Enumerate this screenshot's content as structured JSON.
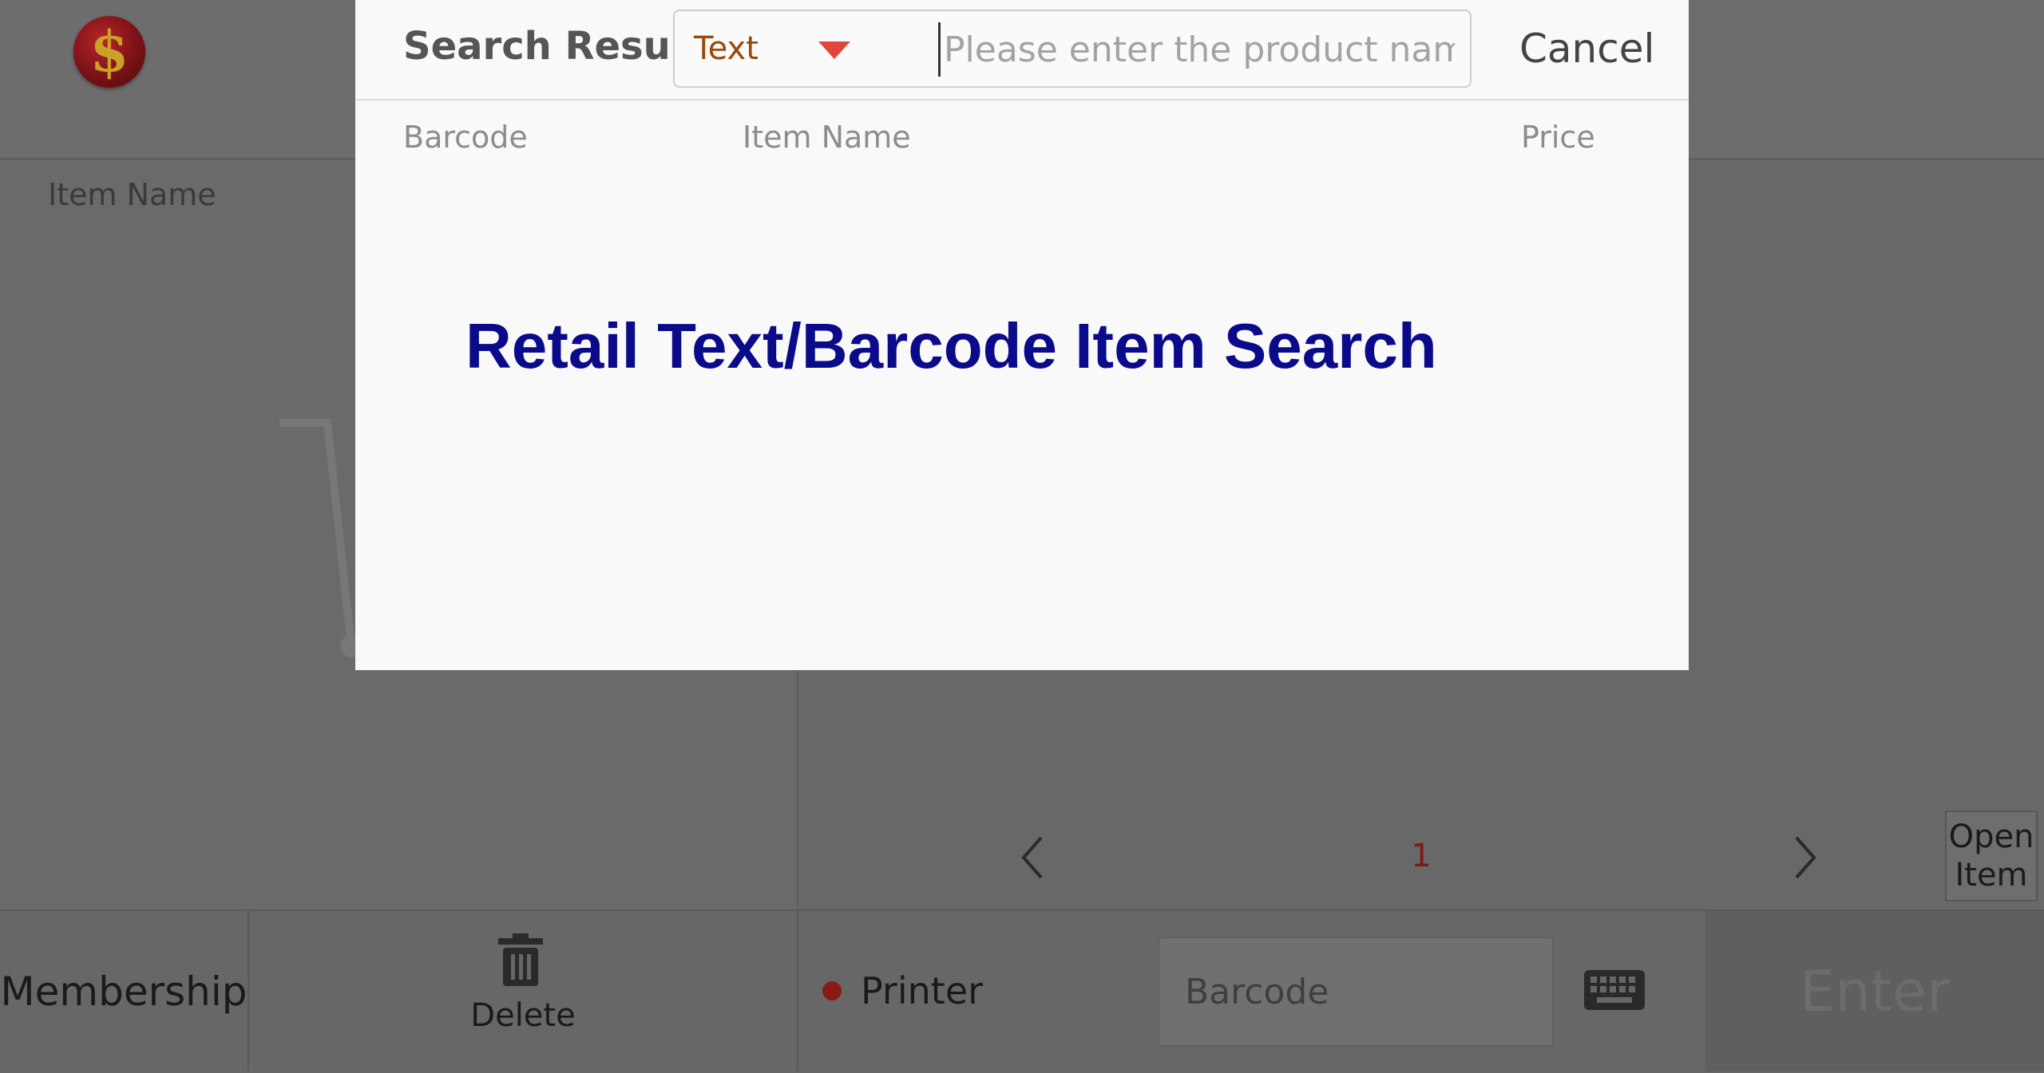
{
  "app": {
    "logo_symbol": "$",
    "item_list_header": "Item Name",
    "pager": {
      "prev_icon": "chevron-left-icon",
      "current_page": "1",
      "next_icon": "chevron-right-icon"
    },
    "open_item_label_line1": "Open",
    "open_item_label_line2": "Item"
  },
  "bottom_bar": {
    "membership_label": "Membership",
    "delete_label": "Delete",
    "printer_label": "Printer",
    "printer_status_color": "#8a1a16",
    "barcode_placeholder": "Barcode",
    "enter_label": "Enter"
  },
  "modal": {
    "title": "Search Results",
    "search_type": "Text",
    "search_placeholder": "Please enter the product name",
    "search_value": "",
    "cancel_label": "Cancel",
    "columns": [
      "Barcode",
      "Item Name",
      "Price"
    ],
    "banner": "Retail Text/Barcode Item Search",
    "banner_color": "#0a0a8a",
    "dropdown_arrow_color": "#e0463b"
  }
}
